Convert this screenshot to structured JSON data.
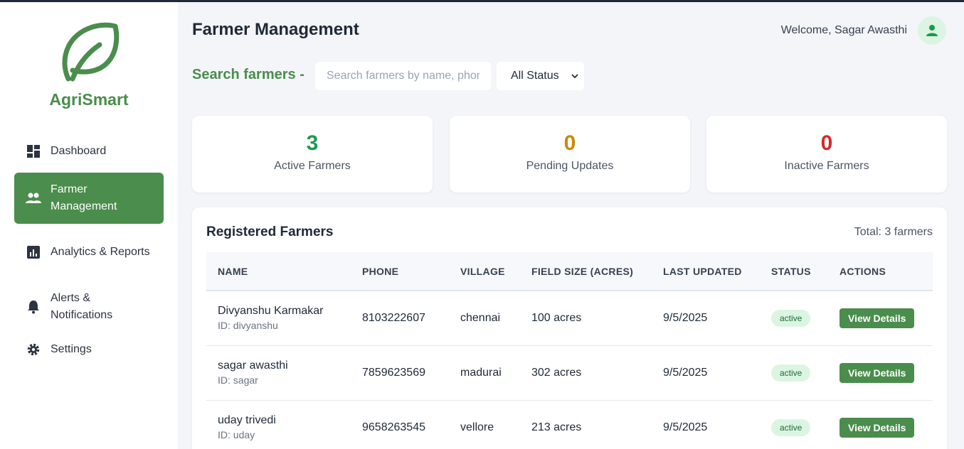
{
  "brand": {
    "name": "AgriSmart",
    "color": "#4a8d4c"
  },
  "sidebar": {
    "items": [
      {
        "label": "Dashboard",
        "icon": "dashboard-icon"
      },
      {
        "label": "Farmer Management",
        "icon": "people-icon",
        "active": true
      },
      {
        "label": "Analytics & Reports",
        "icon": "analytics-icon"
      },
      {
        "label": "Alerts & Notifications",
        "icon": "bell-icon"
      },
      {
        "label": "Settings",
        "icon": "gear-icon"
      }
    ]
  },
  "header": {
    "title": "Farmer Management",
    "welcome": "Welcome, Sagar Awasthi"
  },
  "search": {
    "label": "Search farmers -",
    "placeholder": "Search farmers by name, phone",
    "status_value": "All Status"
  },
  "stats": [
    {
      "value": "3",
      "label": "Active Farmers",
      "color": "#1a9b4a"
    },
    {
      "value": "0",
      "label": "Pending Updates",
      "color": "#c98a0a"
    },
    {
      "value": "0",
      "label": "Inactive Farmers",
      "color": "#d42a2a"
    }
  ],
  "table": {
    "title": "Registered Farmers",
    "total": "Total: 3 farmers",
    "columns": [
      "NAME",
      "PHONE",
      "VILLAGE",
      "FIELD SIZE (ACRES)",
      "LAST UPDATED",
      "STATUS",
      "ACTIONS"
    ],
    "rows": [
      {
        "name": "Divyanshu Karmakar",
        "id": "ID: divyanshu",
        "phone": "8103222607",
        "village": "chennai",
        "field": "100 acres",
        "updated": "9/5/2025",
        "status": "active",
        "action": "View Details"
      },
      {
        "name": "sagar awasthi",
        "id": "ID: sagar",
        "phone": "7859623569",
        "village": "madurai",
        "field": "302 acres",
        "updated": "9/5/2025",
        "status": "active",
        "action": "View Details"
      },
      {
        "name": "uday trivedi",
        "id": "ID: uday",
        "phone": "9658263545",
        "village": "vellore",
        "field": "213 acres",
        "updated": "9/5/2025",
        "status": "active",
        "action": "View Details"
      }
    ]
  }
}
